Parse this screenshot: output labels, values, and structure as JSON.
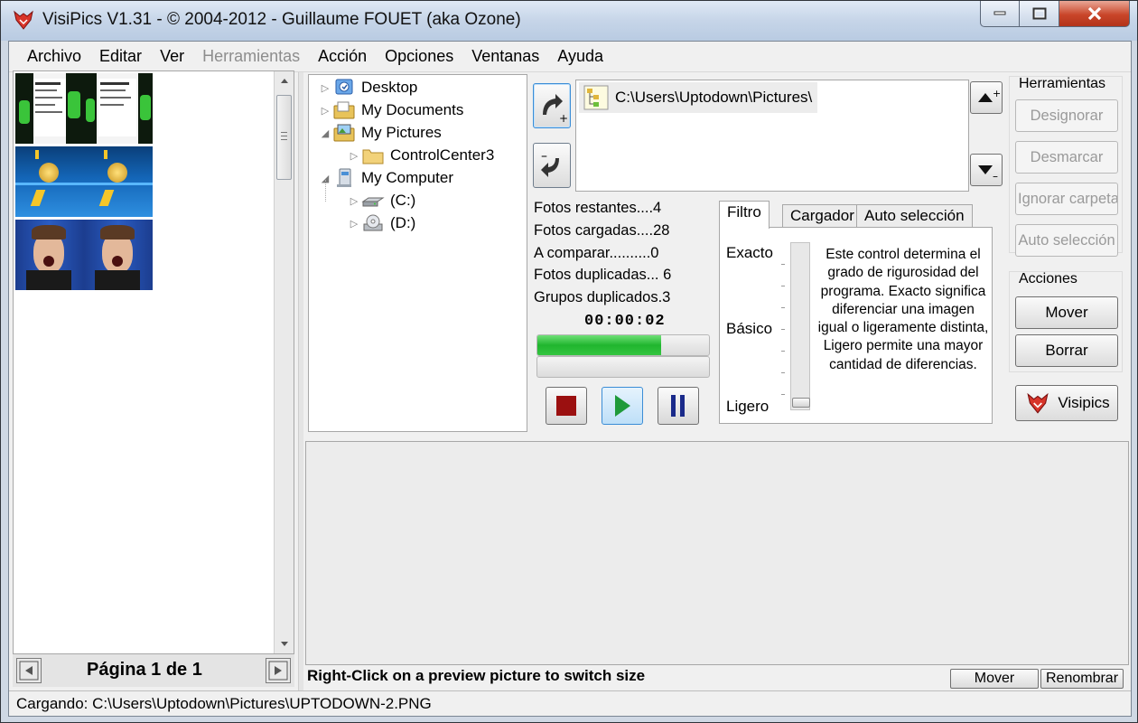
{
  "window": {
    "title": "VisiPics V1.31 - © 2004-2012 - Guillaume FOUET (aka Ozone)",
    "icon": "visipics-fox-icon"
  },
  "menu": [
    "Archivo",
    "Editar",
    "Ver",
    "Herramientas",
    "Acción",
    "Opciones",
    "Ventanas",
    "Ayuda"
  ],
  "menu_disabled_index": 3,
  "thumbnails": {
    "pairs": [
      {
        "theme": "document-screenshot"
      },
      {
        "theme": "blue-coin"
      },
      {
        "theme": "screaming-man"
      }
    ],
    "pager_text": "Página 1 de 1"
  },
  "tree": {
    "items": [
      {
        "label": "Desktop",
        "icon": "desktop-icon"
      },
      {
        "label": "My Documents",
        "icon": "documents-folder-icon"
      },
      {
        "label": "My Pictures",
        "icon": "pictures-folder-icon"
      },
      {
        "label": "ControlCenter3",
        "icon": "folder-icon"
      },
      {
        "label": "My Computer",
        "icon": "computer-icon"
      },
      {
        "label": "(C:)",
        "icon": "hard-drive-icon"
      },
      {
        "label": "(D:)",
        "icon": "optical-drive-icon"
      }
    ]
  },
  "folders": {
    "entries": [
      "C:\\Users\\Uptodown\\Pictures\\"
    ]
  },
  "stats": {
    "fotos_restantes": "Fotos restantes....4",
    "fotos_cargadas": "Fotos cargadas....28",
    "a_comparar": "A comparar..........0",
    "fotos_duplicadas": "Fotos duplicadas... 6",
    "grupos_duplicados": "Grupos duplicados.3"
  },
  "timer": "00:00:02",
  "progress": {
    "loading": 0.72,
    "compare": 0.0
  },
  "tabs": {
    "labels": [
      "Filtro",
      "Cargador",
      "Auto selección"
    ],
    "active": "Filtro",
    "filtro": {
      "levels": [
        "Exacto",
        "Básico",
        "Ligero"
      ],
      "slider_level": "Ligero",
      "description": "Este control determina el grado de rigurosidad del programa. Exacto significa diferenciar una imagen igual o ligeramente distinta, Ligero permite una mayor cantidad de diferencias."
    }
  },
  "tools": {
    "herramientas_title": "Herramientas",
    "buttons": [
      "Designorar",
      "Desmarcar",
      "Ignorar carpeta",
      "Auto selección"
    ],
    "acciones_title": "Acciones",
    "mover": "Mover",
    "borrar": "Borrar",
    "visipics": "Visipics"
  },
  "preview": {
    "hint": "Right-Click on a preview picture to switch size",
    "mover": "Mover",
    "renombrar": "Renombrar"
  },
  "status": "Cargando: C:\\Users\\Uptodown\\Pictures\\UPTODOWN-2.PNG",
  "colors": {
    "progress_green": "#20b52e",
    "stop_red": "#9b1010",
    "play_green": "#1f9a3a",
    "pause_navy": "#1a2a8a"
  }
}
